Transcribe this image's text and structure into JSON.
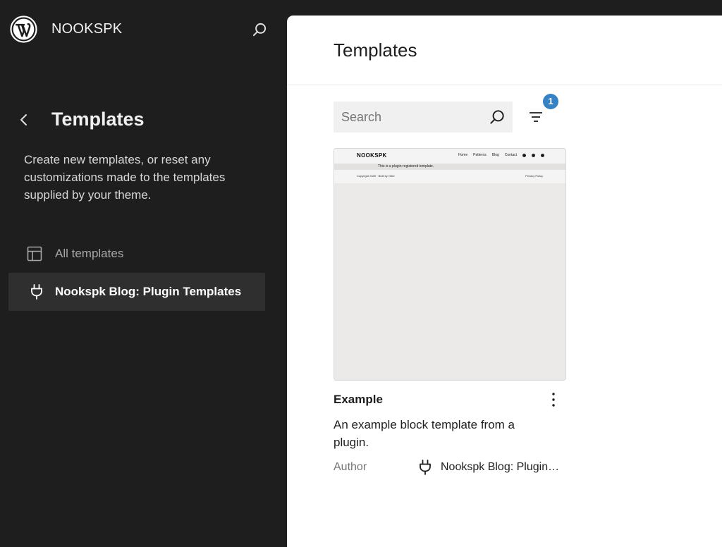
{
  "site": {
    "name": "NOOKSPK"
  },
  "sidebar": {
    "title": "Templates",
    "description": "Create new templates, or reset any customizations made to the templates supplied by your theme.",
    "items": [
      {
        "label": "All templates",
        "icon": "layout-icon",
        "active": false
      },
      {
        "label": "Nookspk Blog: Plugin Templates",
        "icon": "plugin-icon",
        "active": true
      }
    ]
  },
  "main": {
    "title": "Templates",
    "search": {
      "placeholder": "Search",
      "value": ""
    },
    "filter": {
      "badge_count": "1"
    },
    "cards": [
      {
        "title": "Example",
        "description": "An example block template from a plugin.",
        "author_label": "Author",
        "author_value": "Nookspk Blog: Plugin…",
        "preview": {
          "site_title": "NOOKSPK",
          "nav": [
            "Home",
            "Patterns",
            "Blog",
            "Contact"
          ],
          "message": "This is a plugin-registered template.",
          "copyright": "Copyright 2025 · Built by Otter",
          "privacy": "Privacy Policy"
        }
      }
    ]
  },
  "colors": {
    "sidebar_bg": "#1e1e1e",
    "active_item_bg": "#2f2f2f",
    "accent_badge": "#3582c4"
  }
}
